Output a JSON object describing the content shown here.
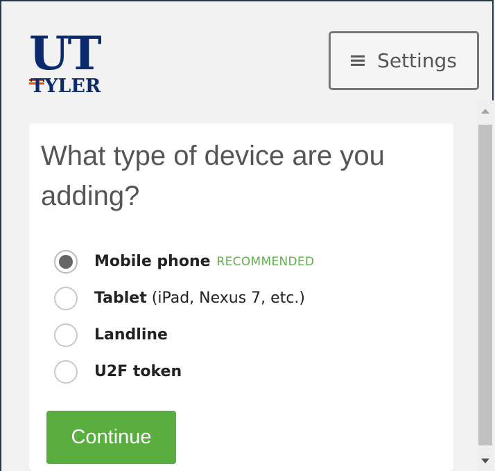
{
  "logo": {
    "line1": "UT",
    "line2": "TYLER"
  },
  "header": {
    "settings_label": "Settings",
    "settings_icon": "hamburger-icon"
  },
  "card": {
    "question": "What type of device are you adding?",
    "options": [
      {
        "label": "Mobile phone",
        "detail": "",
        "badge": "RECOMMENDED",
        "selected": true
      },
      {
        "label": "Tablet",
        "detail": "(iPad, Nexus 7, etc.)",
        "badge": "",
        "selected": false
      },
      {
        "label": "Landline",
        "detail": "",
        "badge": "",
        "selected": false
      },
      {
        "label": "U2F token",
        "detail": "",
        "badge": "",
        "selected": false
      }
    ],
    "continue_label": "Continue"
  },
  "colors": {
    "brand_blue": "#0a2a6b",
    "brand_orange": "#e35205",
    "accent_green": "#5aae40",
    "recommended_green": "#5fb04a"
  }
}
